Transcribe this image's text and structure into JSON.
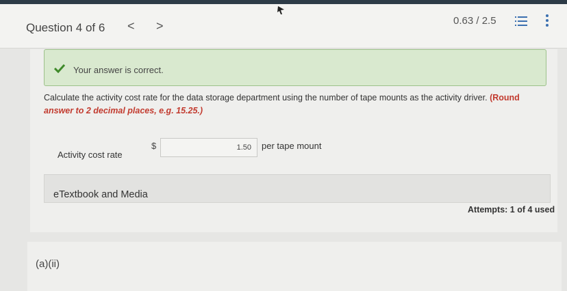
{
  "header": {
    "question_label": "Question 4 of 6",
    "prev_glyph": "<",
    "next_glyph": ">",
    "score": "0.63 / 2.5",
    "icons": [
      "list-icon",
      "more-vertical-icon"
    ]
  },
  "feedback": {
    "icon": "check-icon",
    "message": "Your answer is correct.",
    "color": "#3f8a2a"
  },
  "question": {
    "text": "Calculate the activity cost rate for the data storage department using the number of tape mounts as the activity driver.",
    "hint_open": "(Round",
    "hint_rest": "answer to 2 decimal places, e.g. 15.25.)",
    "hint_color": "#c23a2e"
  },
  "answer": {
    "label": "Activity cost rate",
    "currency": "$",
    "value": "1.50",
    "unit": "per tape mount"
  },
  "etextbook": {
    "label": "eTextbook and Media"
  },
  "attempts": "Attempts: 1 of 4 used",
  "next_part": {
    "label": "(a)(ii)"
  }
}
